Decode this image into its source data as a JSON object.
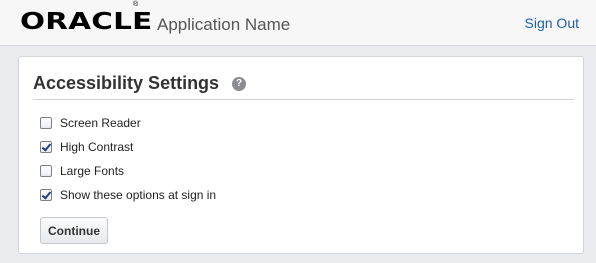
{
  "header": {
    "logo_text": "ORACLE",
    "trademark": "®",
    "app_name": "Application Name",
    "sign_out_label": "Sign Out"
  },
  "settings": {
    "title": "Accessibility Settings",
    "help_icon_glyph": "?",
    "options": [
      {
        "label": "Screen Reader",
        "checked": false
      },
      {
        "label": "High Contrast",
        "checked": true
      },
      {
        "label": "Large Fonts",
        "checked": false
      },
      {
        "label": "Show these options at sign in",
        "checked": true
      }
    ],
    "continue_label": "Continue"
  },
  "colors": {
    "link": "#1f5fa0",
    "page_background": "#e9ebee",
    "help_icon": "#8a8c8f"
  },
  "icons": {
    "help": "help-icon",
    "logo": "oracle-logo"
  }
}
